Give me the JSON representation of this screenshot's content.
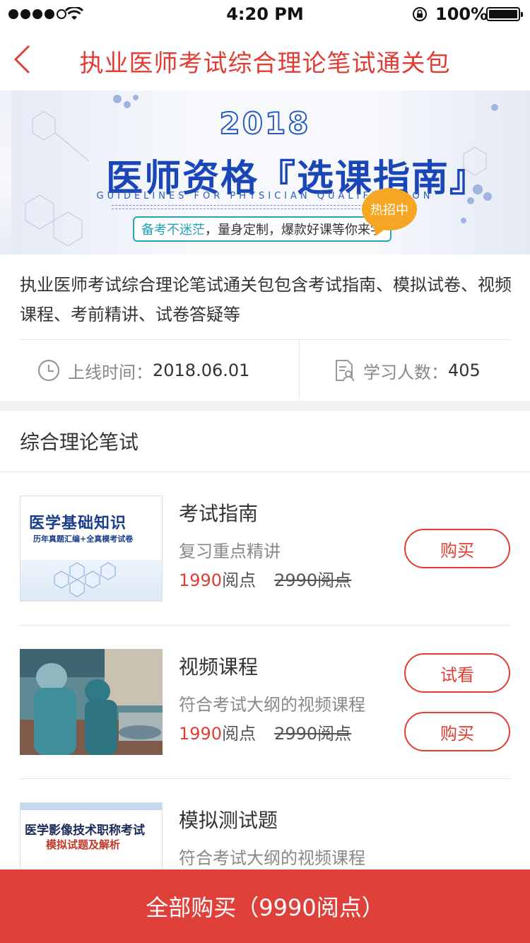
{
  "status_bar": {
    "time": "4:20 PM",
    "battery": "100%",
    "signal_bars": 4
  },
  "nav": {
    "title": "执业医师考试综合理论笔试通关包"
  },
  "banner": {
    "year": "2018",
    "title": "医师资格『选课指南』",
    "subtitle": "GUIDELINES FOR PHYSICIAN QUALIFICATION",
    "slogan_highlight": "备考不迷茫",
    "slogan_rest": "，量身定制，爆款好课等你来学",
    "badge": "热招中"
  },
  "description": "执业医师考试综合理论笔试通关包包含考试指南、模拟试卷、视频课程、考前精讲、试卷答疑等",
  "meta": {
    "online_label": "上线时间：",
    "online_value": "2018.06.01",
    "students_label": "学习人数：",
    "students_value": "405"
  },
  "section": {
    "title": "综合理论笔试"
  },
  "courses": [
    {
      "title": "考试指南",
      "subtitle": "复习重点精讲",
      "price_now": "1990",
      "price_unit": "阅点",
      "price_old": "2990阅点",
      "buttons": [
        "购买"
      ],
      "thumb_title": "医学基础知识",
      "thumb_subtitle": "历年真题汇编+全真模考试卷"
    },
    {
      "title": "视频课程",
      "subtitle": "符合考试大纲的视频课程",
      "price_now": "1990",
      "price_unit": "阅点",
      "price_old": "2990阅点",
      "buttons": [
        "试看",
        "购买"
      ]
    },
    {
      "title": "模拟测试题",
      "subtitle": "符合考试大纲的视频课程",
      "thumb_title": "医学影像技术职称考试",
      "thumb_subtitle": "模拟试题及解析"
    }
  ],
  "buy_all": {
    "label": "全部购买（9990阅点）"
  },
  "colors": {
    "accent": "#e03d35",
    "buy_bar": "#e0403a",
    "badge": "#f5a623"
  }
}
